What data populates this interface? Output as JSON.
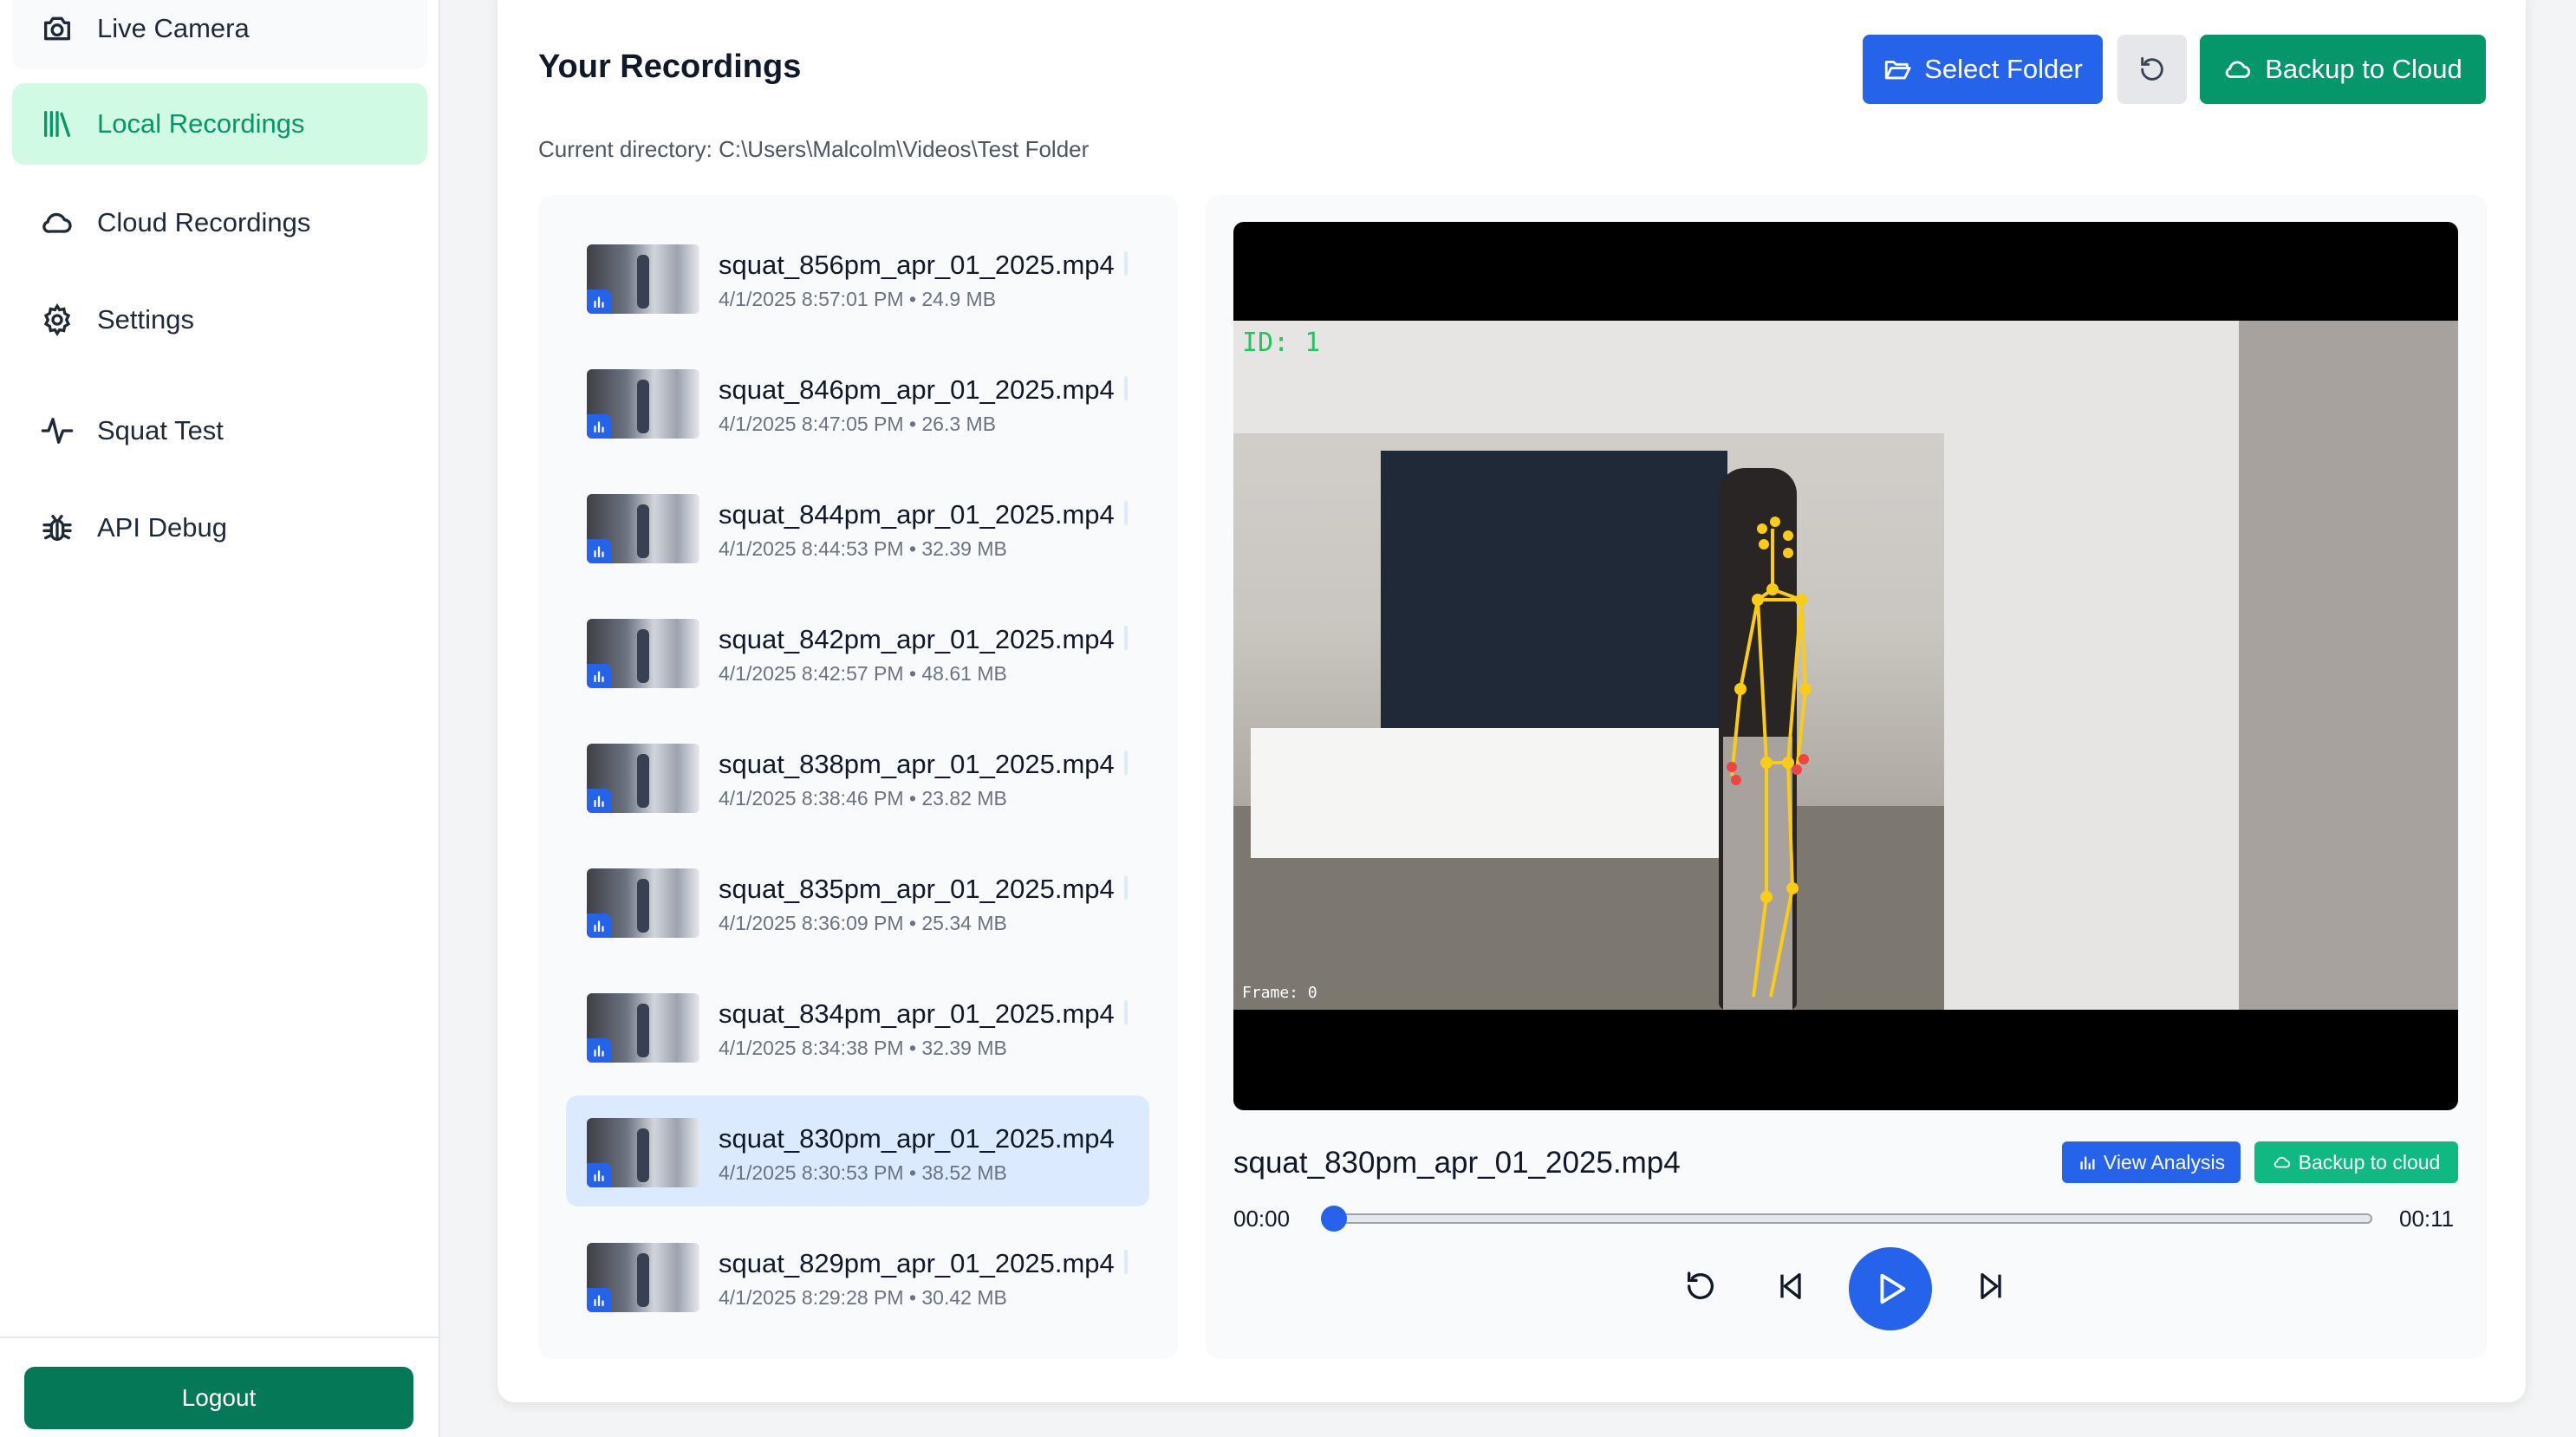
{
  "sidebar": {
    "items": [
      {
        "label": "Live Camera",
        "icon": "camera-icon"
      },
      {
        "label": "Local Recordings",
        "icon": "library-icon",
        "active": true
      },
      {
        "label": "Cloud Recordings",
        "icon": "cloud-icon"
      },
      {
        "label": "Settings",
        "icon": "gear-icon"
      },
      {
        "label": "Squat Test",
        "icon": "activity-icon"
      },
      {
        "label": "API Debug",
        "icon": "bug-icon"
      }
    ],
    "logout_label": "Logout"
  },
  "header": {
    "title": "Your Recordings",
    "select_folder_label": "Select Folder",
    "backup_label": "Backup to Cloud",
    "current_directory": "Current directory: C:\\Users\\Malcolm\\Videos\\Test Folder"
  },
  "files": [
    {
      "name": "squat_856pm_apr_01_2025.mp4",
      "meta": "4/1/2025 8:57:01 PM • 24.9 MB"
    },
    {
      "name": "squat_846pm_apr_01_2025.mp4",
      "meta": "4/1/2025 8:47:05 PM • 26.3 MB"
    },
    {
      "name": "squat_844pm_apr_01_2025.mp4",
      "meta": "4/1/2025 8:44:53 PM • 32.39 MB"
    },
    {
      "name": "squat_842pm_apr_01_2025.mp4",
      "meta": "4/1/2025 8:42:57 PM • 48.61 MB"
    },
    {
      "name": "squat_838pm_apr_01_2025.mp4",
      "meta": "4/1/2025 8:38:46 PM • 23.82 MB"
    },
    {
      "name": "squat_835pm_apr_01_2025.mp4",
      "meta": "4/1/2025 8:36:09 PM • 25.34 MB"
    },
    {
      "name": "squat_834pm_apr_01_2025.mp4",
      "meta": "4/1/2025 8:34:38 PM • 32.39 MB"
    },
    {
      "name": "squat_830pm_apr_01_2025.mp4",
      "meta": "4/1/2025 8:30:53 PM • 38.52 MB",
      "selected": true
    },
    {
      "name": "squat_829pm_apr_01_2025.mp4",
      "meta": "4/1/2025 8:29:28 PM • 30.42 MB"
    }
  ],
  "player": {
    "overlay_id": "ID: 1",
    "overlay_frame": "Frame: 0",
    "title": "squat_830pm_apr_01_2025.mp4",
    "view_analysis_label": "View Analysis",
    "backup_cloud_label": "Backup to cloud",
    "time_current": "00:00",
    "time_total": "00:11",
    "progress": 0
  },
  "colors": {
    "primary": "#2563eb",
    "success": "#059669",
    "active_nav_bg": "#d1fae5",
    "selected_row_bg": "#dbeafe"
  }
}
